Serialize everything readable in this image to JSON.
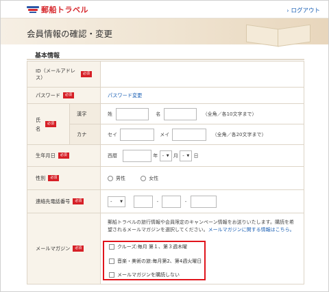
{
  "header": {
    "logo_text": "郵船トラベル",
    "logout_label": "ログアウト"
  },
  "page": {
    "title": "会員情報の確認・変更",
    "section_title": "基本情報"
  },
  "required_badge": "必須",
  "fields": {
    "id": {
      "label": "ID（メールアドレス）"
    },
    "password": {
      "label": "パスワード",
      "link": "パスワード変更"
    },
    "name": {
      "label": "氏名",
      "kanji": {
        "label": "漢字",
        "sei": "姓",
        "mei": "名",
        "hint": "（全角／各10文字まで）"
      },
      "kana": {
        "label": "カナ",
        "sei": "セイ",
        "mei": "メイ",
        "hint": "（全角／各20文字まで）"
      }
    },
    "birthday": {
      "label": "生年月日",
      "era": "西暦",
      "year": "年",
      "month": "月",
      "day": "日",
      "month_value": "-",
      "day_value": "-"
    },
    "gender": {
      "label": "性別",
      "male": "男性",
      "female": "女性"
    },
    "phone": {
      "label": "連絡先電話番号",
      "prefix_value": "-",
      "dash": "-"
    },
    "magazine": {
      "label": "メールマガジン",
      "description": "郵船トラベルの旅行情報や会員限定のキャンペーン情報をお送りいたします。購読を希望されるメールマガジンを選択してください。",
      "info_link": "メールマガジンに関する情報はこちら。",
      "options": [
        "クルーズ:毎月 第１、第３週木曜",
        "音楽・美術の旅:毎月第2、第4週火曜日",
        "メールマガジンを購読しない"
      ]
    }
  },
  "colors": {
    "required_red": "#d61f26",
    "link_blue": "#1a5fb4",
    "highlight_red": "#e0141b",
    "label_bg": "#f8f3ea"
  }
}
